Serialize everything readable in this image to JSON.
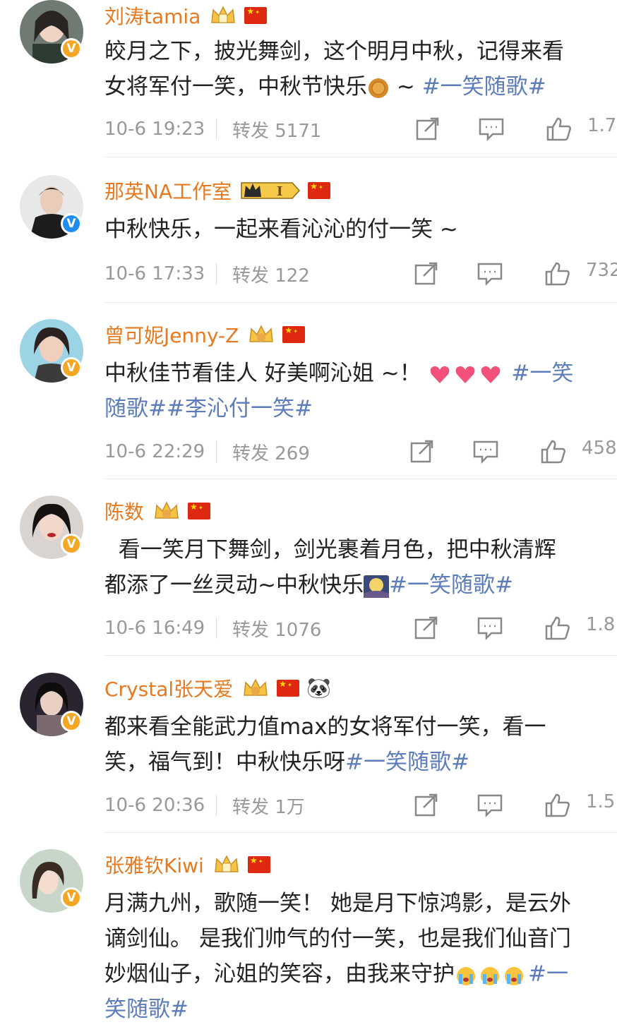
{
  "labels": {
    "repost_prefix": "转发"
  },
  "posts": [
    {
      "name": "刘涛tamia",
      "avatar": "avatar-liutao",
      "verified": "orange",
      "badge": "crown",
      "line1": "皎月之下，披光舞剑，这个明月中秋，记得来看",
      "line2a": "女将军付一笑，中秋节快乐",
      "line2emoji": "mooncake-emoji",
      "line2b": " ~ ",
      "line2tag": "#一笑随歌#",
      "time": "10-6 19:23",
      "repost": "转发 5171",
      "likes": "1.7"
    },
    {
      "name": "那英NA工作室",
      "avatar": "avatar-naying",
      "verified": "blue",
      "badge": "vip",
      "vip_text": "I",
      "line1": "中秋快乐，一起来看沁沁的付一笑 ~",
      "time": "10-6 17:33",
      "repost": "转发 122",
      "likes": "732"
    },
    {
      "name": "曾可妮Jenny-Z",
      "avatar": "avatar-zengkeni",
      "verified": "orange",
      "badge": "crown",
      "line1a": "中秋佳节看佳人 好美啊沁姐  ~！",
      "line1emoji": "heart-emoji",
      "line1tag": "#一笑",
      "line2tag": "随歌##李沁付一笑#",
      "time": "10-6 22:29",
      "repost": "转发 269",
      "likes": "458"
    },
    {
      "name": "陈数",
      "avatar": "avatar-chenshu",
      "verified": "orange",
      "badge": "crown",
      "line1": "  看一笑月下舞剑，剑光裹着月色，把中秋清辉",
      "line2a": "都添了一丝灵动~中秋快乐",
      "line2emoji": "moon-emoji",
      "line2tag": "#一笑随歌#",
      "time": "10-6 16:49",
      "repost": "转发 1076",
      "likes": "1.8"
    },
    {
      "name": "Crystal张天爱",
      "avatar": "avatar-zhangtianai",
      "verified": "orange",
      "badge": "crown",
      "panda": "🐼",
      "line1": "都来看全能武力值max的女将军付一笑，看一",
      "line2a": "笑，福气到！中秋快乐呀",
      "line2tag": "#一笑随歌#",
      "time": "10-6 20:36",
      "repost": "转发 1万",
      "likes": "1.5"
    },
    {
      "name": "张雅钦Kiwi",
      "avatar": "avatar-zhangyaqin",
      "verified": "orange",
      "badge": "crown",
      "line1": "月满九州，歌随一笑！ 她是月下惊鸿影，是云外",
      "line2": "谪剑仙。 是我们帅气的付一笑，也是我们仙音门",
      "line3a": "妙烟仙子，沁姐的笑容，由我来守护",
      "line3emoji": "crying-emoji",
      "line3tag": "#一",
      "line4tag": "笑随歌#"
    }
  ],
  "colors": {
    "name": "#e8791f",
    "hashtag": "#5c7cbc",
    "meta": "#999999",
    "verified_orange": "#f5a623",
    "verified_blue": "#1f8ef1"
  }
}
